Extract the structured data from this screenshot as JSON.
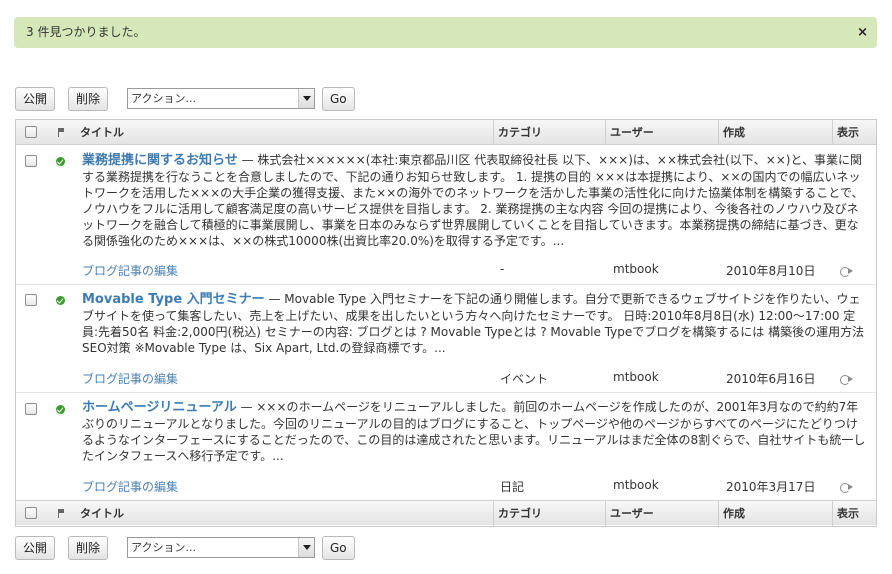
{
  "message": {
    "text": "3 件見つかりました。",
    "close": "×"
  },
  "actions": {
    "publish_label": "公開",
    "delete_label": "削除",
    "action_select": "アクション...",
    "go_label": "Go"
  },
  "table": {
    "headers": {
      "title": "タイトル",
      "category": "カテゴリ",
      "user": "ユーザー",
      "created": "作成",
      "view": "表示"
    },
    "rows": [
      {
        "title": "業務提携に関するお知らせ",
        "excerpt": " — 株式会社××××××(本社:東京都品川区 代表取締役社長 以下、×××)は、××株式会社(以下、××)と、事業に関する業務提携を行なうことを合意しましたので、下記の通りお知らせ致します。 1. 提携の目的 ×××は本提携により、××の国内での幅広いネットワークを活用した×××の大手企業の獲得支援、また××の海外でのネットワークを活かした事業の活性化に向けた協業体制を構築することで、ノウハウをフルに活用して顧客満足度の高いサービス提供を目指します。 2. 業務提携の主な内容 今回の提携により、今後各社のノウハウ及びネットワークを融合して積極的に事業展開し、事業を日本のみならず世界展開していくことを目指していきます。本業務提携の締結に基づき、更なる関係強化のため×××は、××の株式10000株(出資比率20.0%)を取得する予定です。...",
        "edit": "ブログ記事の編集",
        "category": "-",
        "user": "mtbook",
        "date": "2010年8月10日"
      },
      {
        "title": "Movable Type 入門セミナー",
        "excerpt": " — Movable Type 入門セミナーを下記の通り開催します。自分で更新できるウェブサイトジを作りたい、ウェブサイトを使って集客したい、売上を上げたい、成果を出したいという方々へ向けたセミナーです。 日時:2010年8月8日(水) 12:00～17:00 定員:先着50名 料金:2,000円(税込) セミナーの内容: ブログとは ? Movable Typeとは ? Movable Typeでブログを構築するには 構築後の運用方法 SEO対策 ※Movable Type は、Six Apart, Ltd.の登録商標です。...",
        "edit": "ブログ記事の編集",
        "category": "イベント",
        "user": "mtbook",
        "date": "2010年6月16日"
      },
      {
        "title": "ホームページリニューアル",
        "excerpt": " — ×××のホームページをリニューアルしました。前回のホームページを作成したのが、2001年3月なので約約7年ぶりのリニューアルとなりました。今回のリニューアルの目的はブログにすること、トップページや他のページからすべてのページにたどりつけるようなインターフェースにすることだったので、この目的は達成されたと思います。リニューアルはまだ全体の8割ぐらで、自社サイトも統一したインタフェースへ移行予定です。...",
        "edit": "ブログ記事の編集",
        "category": "日記",
        "user": "mtbook",
        "date": "2010年3月17日"
      }
    ]
  }
}
